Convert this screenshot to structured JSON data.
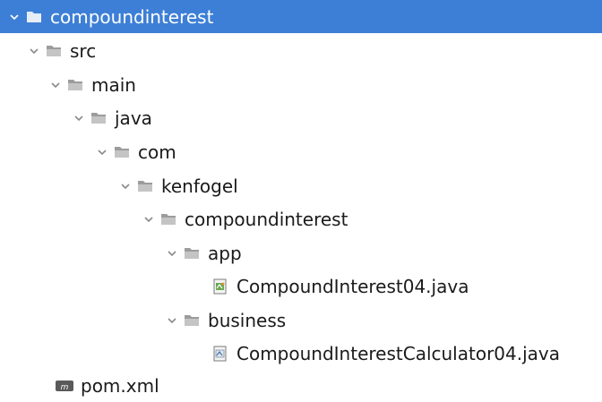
{
  "tree": {
    "root_label": "compoundinterest",
    "src_label": "src",
    "main_label": "main",
    "java_label": "java",
    "com_label": "com",
    "kenfogel_label": "kenfogel",
    "pkg_label": "compoundinterest",
    "app_label": "app",
    "app_file_label": "CompoundInterest04.java",
    "business_label": "business",
    "business_file_label": "CompoundInterestCalculator04.java",
    "pom_label": "pom.xml"
  },
  "colors": {
    "selection": "#3d7fd6",
    "folder": "#b8b8b8",
    "chevron": "#8a8a8a"
  },
  "icons": {
    "folder": "folder-icon",
    "java_file": "java-file-icon",
    "maven": "maven-icon",
    "chevron": "chevron-down-icon"
  }
}
